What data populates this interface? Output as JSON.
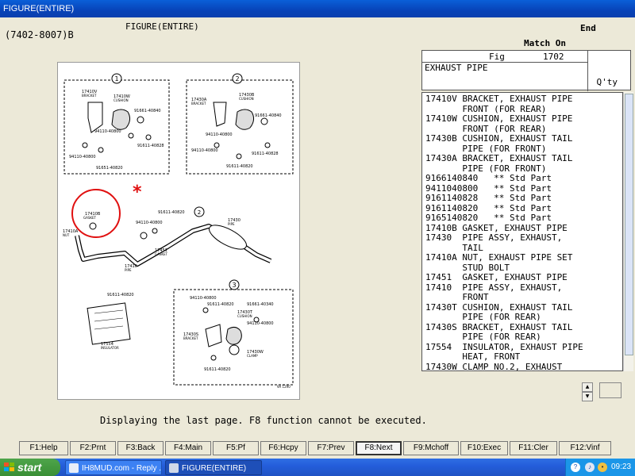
{
  "window": {
    "title": "FIGURE(ENTIRE)"
  },
  "header": {
    "code": "(7402-8007)B",
    "figure_label": "FIGURE(ENTIRE)",
    "end_label": "End",
    "match_label": "Match On"
  },
  "fig_panel": {
    "fig_label": "Fig",
    "fig_number": "1702",
    "title": "EXHAUST PIPE",
    "qty_label": "Q'ty"
  },
  "parts": [
    "17410V BRACKET, EXHAUST PIPE",
    "       FRONT (FOR REAR)",
    "17410W CUSHION, EXHAUST PIPE",
    "       FRONT (FOR REAR)",
    "17430B CUSHION, EXHAUST TAIL",
    "       PIPE (FOR FRONT)",
    "17430A BRACKET, EXHAUST TAIL",
    "       PIPE (FOR FRONT)",
    "9166140840   ** Std Part",
    "9411040800   ** Std Part",
    "9161140828   ** Std Part",
    "9161140820   ** Std Part",
    "9165140820   ** Std Part",
    "17410B GASKET, EXHAUST PIPE",
    "17430  PIPE ASSY, EXHAUST,",
    "       TAIL",
    "17410A NUT, EXHAUST PIPE SET",
    "       STUD BOLT",
    "17451  GASKET, EXHAUST PIPE",
    "17410  PIPE ASSY, EXHAUST,",
    "       FRONT",
    "17430T CUSHION, EXHAUST TAIL",
    "       PIPE (FOR REAR)",
    "17430S BRACKET, EXHAUST TAIL",
    "       PIPE (FOR REAR)",
    "17554  INSULATOR, EXHAUST PIPE",
    "       HEAT, FRONT",
    "17430W CLAMP NO.2, EXHAUST"
  ],
  "diagram": {
    "callouts": [
      "1",
      "2",
      "3"
    ],
    "labels_1": [
      "17410V",
      "BRACKET",
      "17410W",
      "CUSHION",
      "91661-40840",
      "94110-40800",
      "91611-40828",
      "94110-40800",
      "91651-40820"
    ],
    "labels_2": [
      "17430A",
      "BRACKET",
      "17430B",
      "CUSHION",
      "91661-40840",
      "94110-40800",
      "94110-40800",
      "91611-40828",
      "91611-40820"
    ],
    "labels_main": [
      "17410B",
      "GASKET",
      "17410A",
      "NUT",
      "91611-40820",
      "94110-40800",
      "17430",
      "PIPE",
      "17451",
      "GASKET",
      "17410",
      "PIPE"
    ],
    "labels_3": [
      "91611-40820",
      "94110-40800",
      "91611-40820",
      "91661-40340",
      "17430T",
      "CUSHION",
      "17430S",
      "BRACKET",
      "94110-40800",
      "17430W",
      "CLAMP",
      "91611-40820",
      "17554",
      "INSULATOR",
      "9A 1290"
    ],
    "highlight_mark": "*"
  },
  "status": {
    "message": "Displaying the last page.  F8 function cannot be executed."
  },
  "fkeys": [
    "F1:Help",
    "F2:Prnt",
    "F3:Back",
    "F4:Main",
    "F5:Pf",
    "F6:Hcpy",
    "F7:Prev",
    "F8:Next",
    "F9:Mchoff",
    "F10:Exec",
    "F11:Cler",
    "F12:Vinf"
  ],
  "taskbar": {
    "start": "start",
    "tasks": [
      "IH8MUD.com - Reply ...",
      "FIGURE(ENTIRE)"
    ],
    "clock": "09:23"
  },
  "colors": {
    "title_blue": "#0a5fd8",
    "highlight_red": "#e01010",
    "taskbar_blue": "#245edb",
    "start_green": "#3a8f36"
  }
}
